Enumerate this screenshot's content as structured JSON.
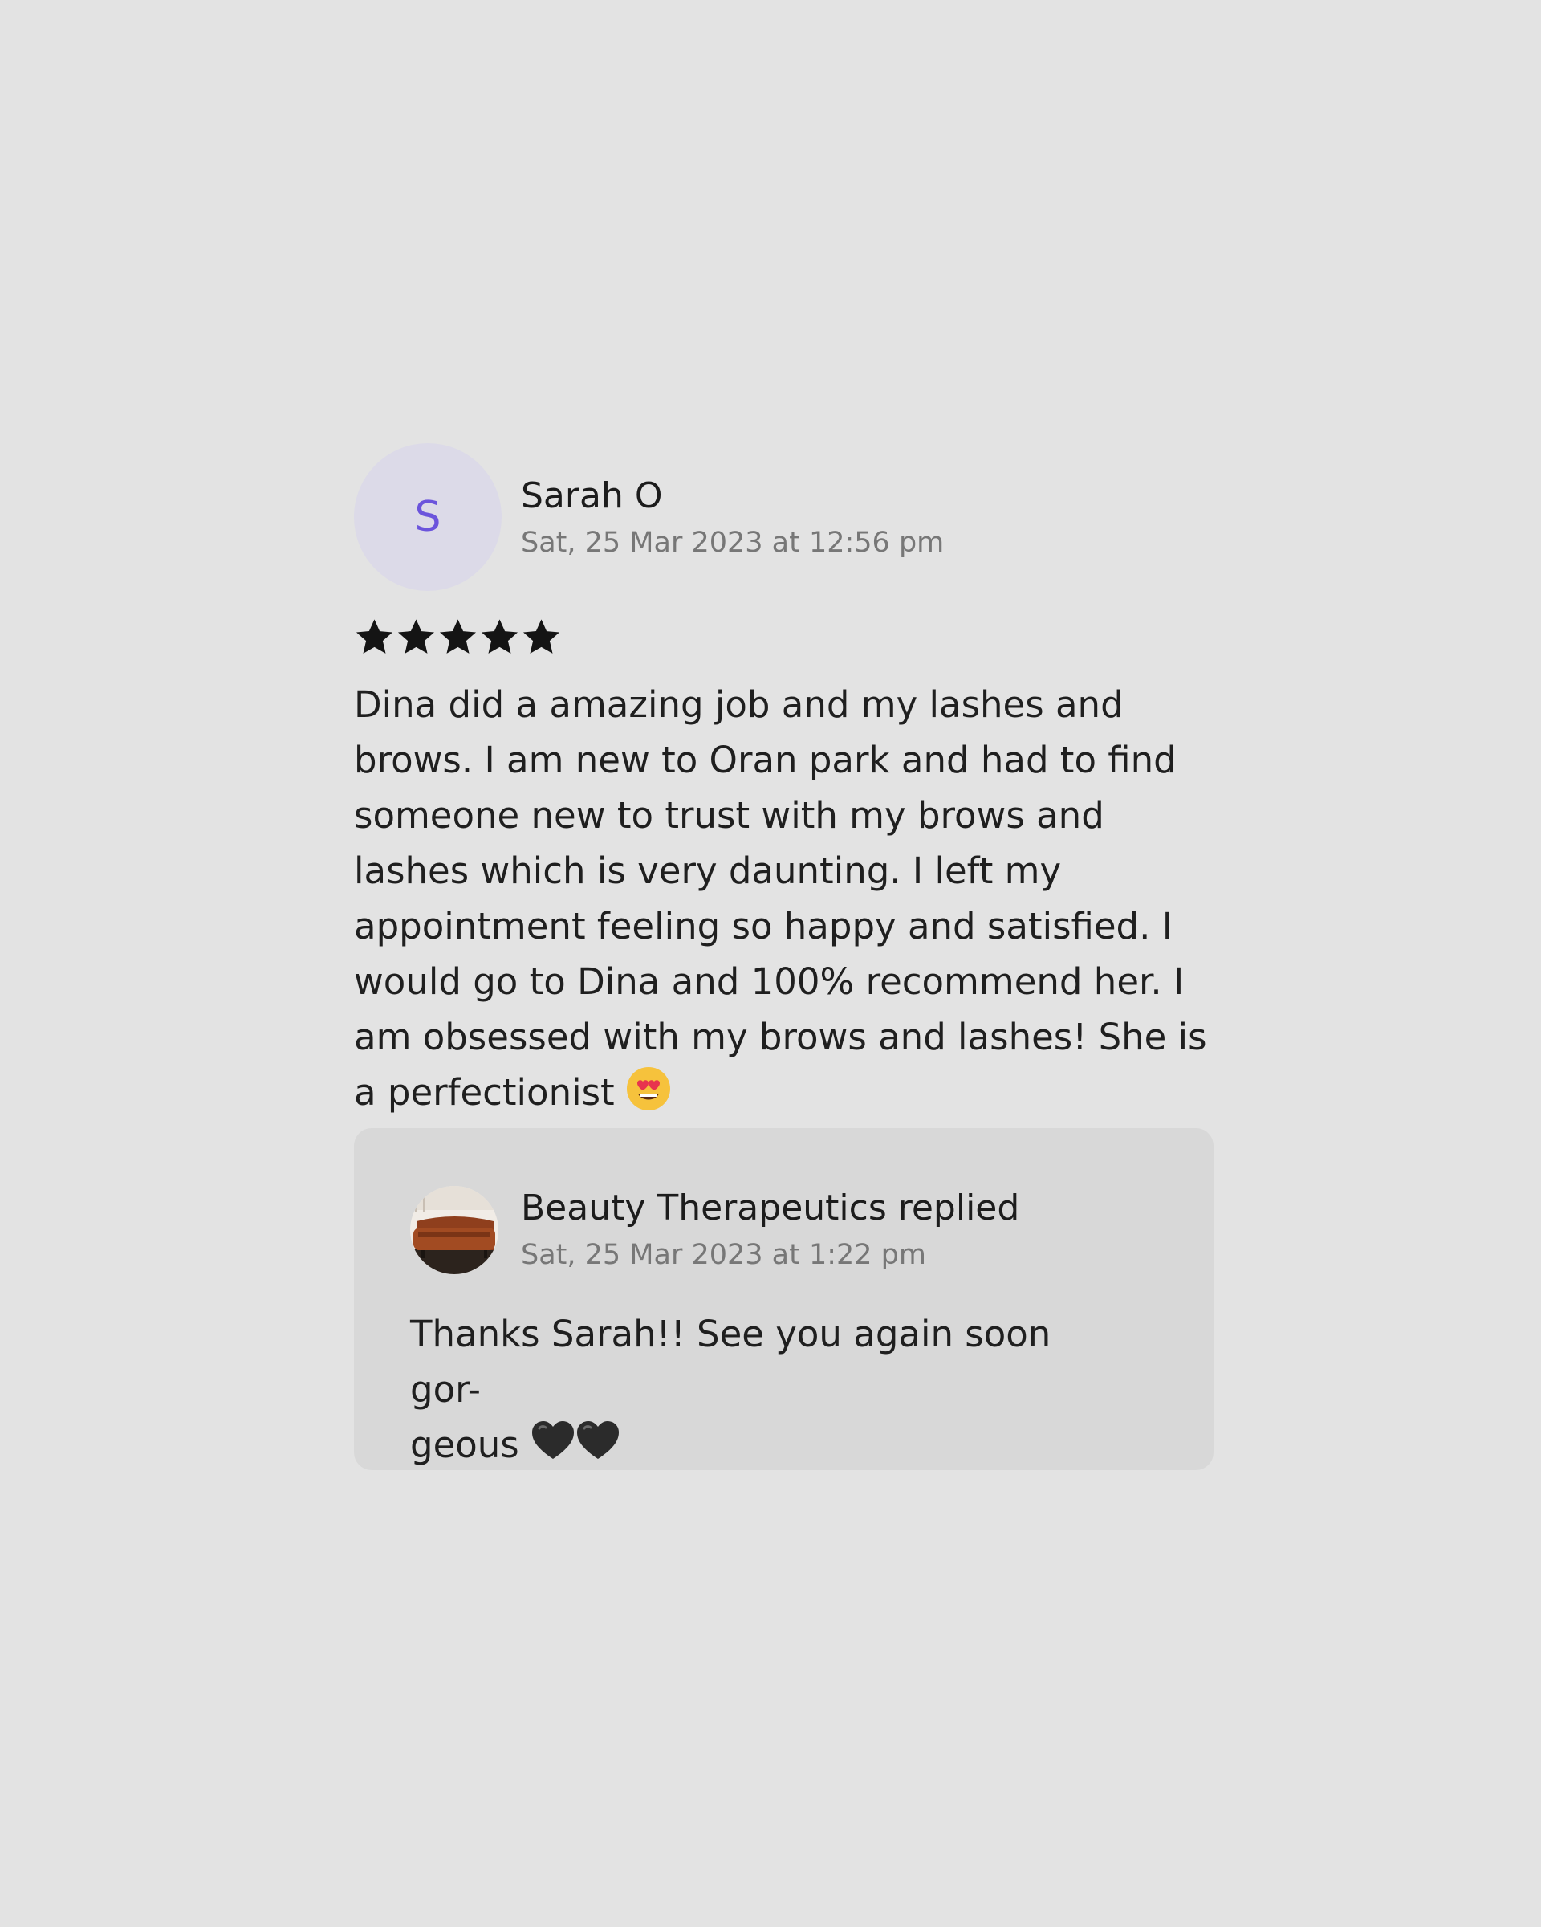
{
  "review": {
    "avatar_initial": "S",
    "reviewer_name": "Sarah O",
    "date": "Sat, 25 Mar 2023 at 12:56 pm",
    "rating": 5,
    "rating_max": 5,
    "text": "Dina did a amazing job and my lashes and brows. I am new to Oran park and had to find someone new to trust with my brows and lashes which is very daunting. I left my appointment feeling so happy and satisfied. I would go to Dina and 100% recommend her. I am obsessed with my brows and lashes! She is a perfectionist",
    "emoji_icon": "heart-eyes-emoji-icon"
  },
  "reply": {
    "business_name": "Beauty Therapeutics replied",
    "date": "Sat, 25 Mar 2023 at 1:22 pm",
    "text_line1": "Thanks Sarah!! See you again soon gor-",
    "text_line2": "geous",
    "emoji_icon": "black-heart-icon",
    "emoji_count": 2
  },
  "colors": {
    "background": "#e3e3e3",
    "avatar_bg": "#dcdae8",
    "avatar_letter": "#6b54dc",
    "reply_bg": "#d8d8d8",
    "muted_text": "#777777"
  }
}
